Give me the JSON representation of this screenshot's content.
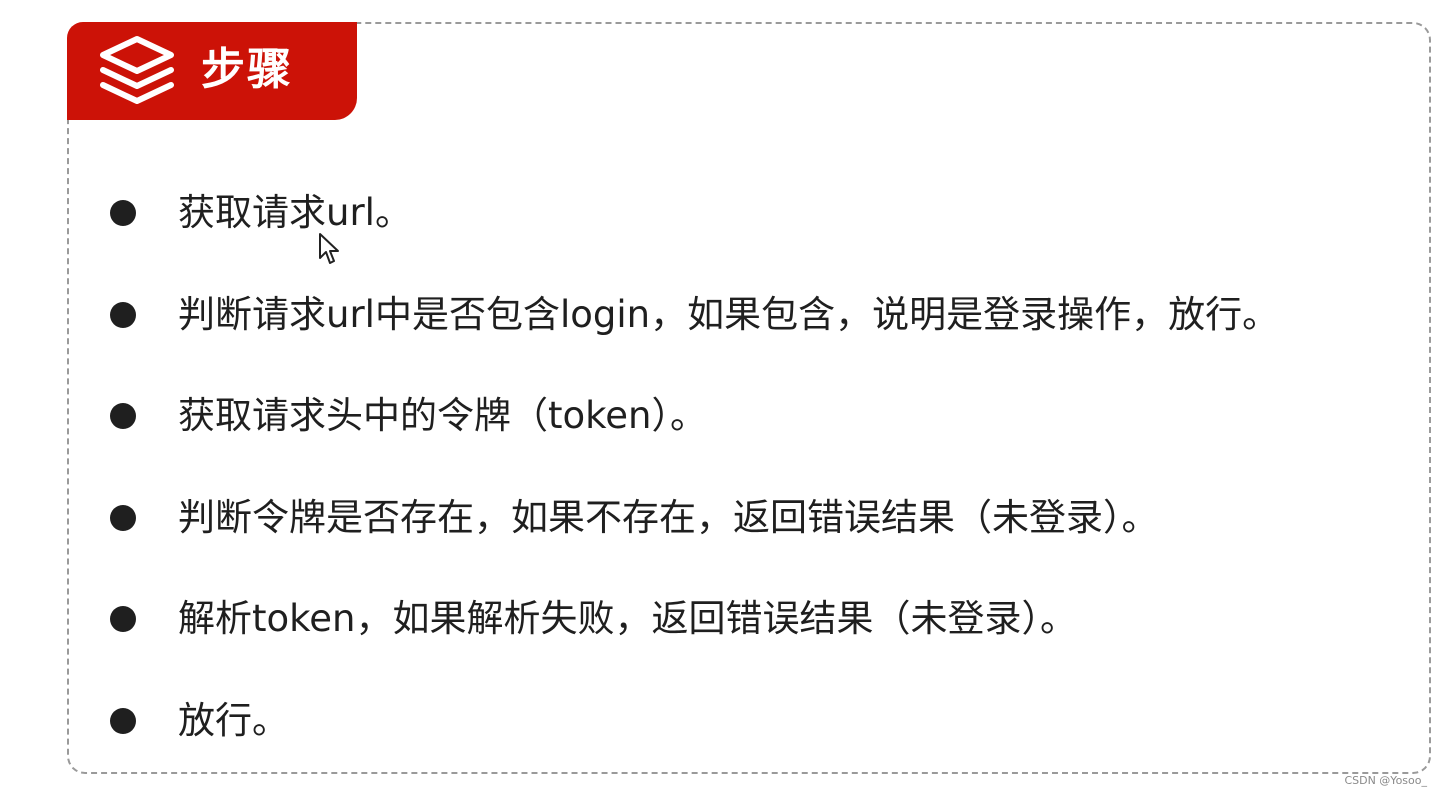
{
  "header": {
    "title": "步骤",
    "icon": "layers-icon",
    "color": "#cc1207"
  },
  "steps": [
    "获取请求url。",
    "判断请求url中是否包含login，如果包含，说明是登录操作，放行。",
    "获取请求头中的令牌（token）。",
    "判断令牌是否存在，如果不存在，返回错误结果（未登录）。",
    "解析token，如果解析失败，返回错误结果（未登录）。",
    "放行。"
  ],
  "watermark": "CSDN @Yosoo_"
}
